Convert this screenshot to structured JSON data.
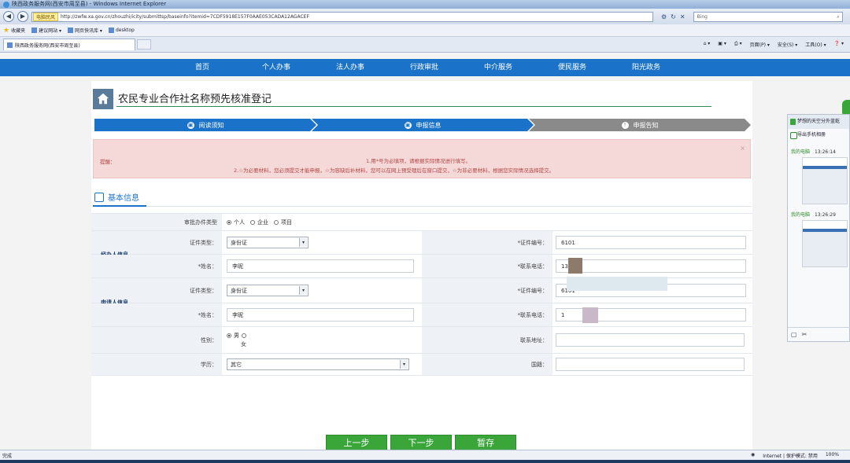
{
  "window": {
    "title": "陕西政务服务网(西安市周至县) - Windows Internet Explorer"
  },
  "address": {
    "tag": "电脑民风",
    "url": "http://zwfw.xa.gov.cn/zhouzhi/icity/submittsp/baseinfo?itemid=7CDF5918E157F0AAE053CADA12AGACEF",
    "search_placeholder": "Bing"
  },
  "favorites": {
    "label": "收藏夹",
    "items": [
      "建议网站 ▾",
      "网页快讯库 ▾",
      "desktop"
    ]
  },
  "tab": {
    "title": "陕西政务服务网(西安市周至县)"
  },
  "commands": [
    "页面(P) ▾",
    "安全(S) ▾",
    "工具(O) ▾",
    "❓ ▾"
  ],
  "nav": [
    "首页",
    "个人办事",
    "法人办事",
    "行政审批",
    "中介服务",
    "便民服务",
    "阳光政务"
  ],
  "page": {
    "title": "农民专业合作社名称预先核准登记"
  },
  "steps": [
    {
      "icon": "▣",
      "label": "阅读须知"
    },
    {
      "icon": "▣",
      "label": "申报信息"
    },
    {
      "icon": "!",
      "label": "申报告知"
    }
  ],
  "notice": {
    "label": "提醒：",
    "line1": "1.用*号为必填项，请根据实际情况进行填写。",
    "line2": "2.☆为必要材料，您必须提交才能申报，☆为容缺后补材料，您可以在网上预受理后在窗口提交，☆为非必要材料，根据您实际情况选择提交。",
    "close": "×"
  },
  "section": {
    "title": "基本信息"
  },
  "form": {
    "applicant_type_label": "审批办件类型",
    "applicant_type_options": [
      "个人",
      "企业",
      "项目"
    ],
    "handler_group": "经办人信息",
    "applicant_group": "申请人信息",
    "id_type_label": "证件类型：",
    "id_type_value": "身份证",
    "name_label": "*姓名：",
    "handler_name": "李昵",
    "applicant_name": "李昵",
    "id_no_label": "*证件编号：",
    "handler_id_no": "6101",
    "applicant_id_no": "6101",
    "phone_label": "*联系电话：",
    "handler_phone": "13",
    "applicant_phone": "1",
    "gender_label": "性别：",
    "gender_options": [
      "男",
      "女"
    ],
    "education_label": "学历：",
    "education_value": "其它",
    "address_label": "联系地址：",
    "nationality_label": "国籍："
  },
  "buttons": {
    "prev": "上一步",
    "next": "下一步",
    "save": "暂存"
  },
  "popup": {
    "title": "梦想的天空分外蓝乾",
    "export": "导出手机相册",
    "messages": [
      {
        "sender": "我的电脑",
        "time": "13:26:14"
      },
      {
        "sender": "我的电脑",
        "time": "13:26:29"
      }
    ]
  },
  "status": {
    "left": "完成",
    "zone": "Internet | 保护模式: 禁用",
    "zoom": "100%"
  }
}
